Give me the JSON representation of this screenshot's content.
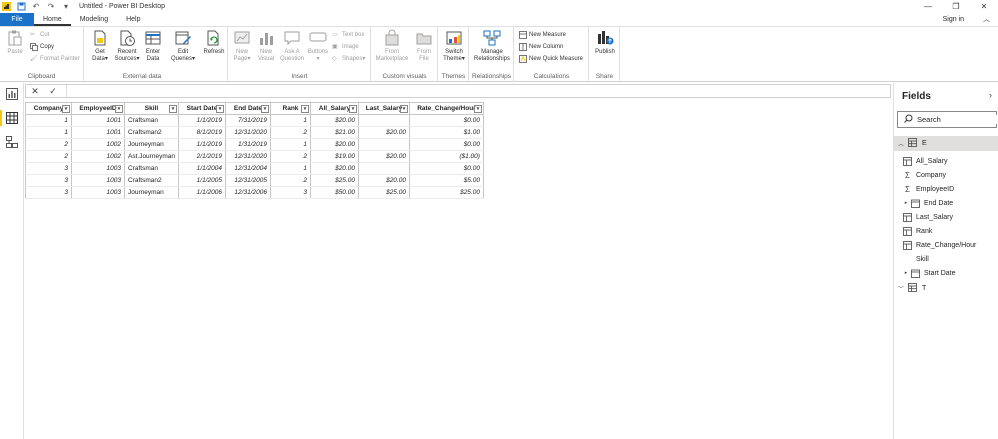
{
  "window": {
    "title": "Untitled - Power BI Desktop",
    "minimize_icon": "minimize-icon",
    "restore_icon": "restore-icon",
    "close_icon": "close-icon"
  },
  "tabs": [
    {
      "label": "File"
    },
    {
      "label": "Home"
    },
    {
      "label": "Modeling"
    },
    {
      "label": "Help"
    }
  ],
  "signin": "Sign in",
  "ribbon": {
    "clipboard": {
      "label": "Clipboard",
      "paste": "Paste",
      "cut": "Cut",
      "copy": "Copy",
      "format_painter": "Format Painter"
    },
    "external_data": {
      "label": "External data",
      "get_data": "Get Data",
      "recent_sources": "Recent Sources",
      "enter_data": "Enter Data",
      "edit_queries": "Edit Queries"
    },
    "refresh": "Refresh",
    "insert": {
      "label": "Insert",
      "new_page": "New Page",
      "new_visual": "New Visual",
      "ask_question": "Ask A Question",
      "buttons": "Buttons",
      "text_box": "Text box",
      "image": "Image",
      "shapes": "Shapes"
    },
    "custom_visuals": {
      "label": "Custom visuals",
      "from_marketplace": "From Marketplace",
      "from_file": "From File"
    },
    "themes": {
      "label": "Themes",
      "switch_theme": "Switch Theme"
    },
    "relationships": {
      "label": "Relationships",
      "manage": "Manage Relationships"
    },
    "calculations": {
      "label": "Calculations",
      "new_measure": "New Measure",
      "new_column": "New Column",
      "new_quick_measure": "New Quick Measure"
    },
    "share": {
      "label": "Share",
      "publish": "Publish"
    }
  },
  "table": {
    "columns": [
      "Company",
      "EmployeeID",
      "Skill",
      "Start Date",
      "End Date",
      "Rank",
      "All_Salary",
      "Last_Salary",
      "Rate_Change/Hour"
    ],
    "rows": [
      [
        "1",
        "1001",
        "Craftsman",
        "1/1/2019",
        "7/31/2019",
        "1",
        "$20.00",
        "",
        "$0.00"
      ],
      [
        "1",
        "1001",
        "Craftsman2",
        "8/1/2019",
        "12/31/2020",
        "2",
        "$21.00",
        "$20.00",
        "$1.00"
      ],
      [
        "2",
        "1002",
        "Journeyman",
        "1/1/2019",
        "1/31/2019",
        "1",
        "$20.00",
        "",
        "$0.00"
      ],
      [
        "2",
        "1002",
        "Ast.Journeyman",
        "2/1/2019",
        "12/31/2020",
        "2",
        "$19.00",
        "$20.00",
        "($1.00)"
      ],
      [
        "3",
        "1003",
        "Craftsman",
        "1/1/2004",
        "12/31/2004",
        "1",
        "$20.00",
        "",
        "$0.00"
      ],
      [
        "3",
        "1003",
        "Craftsman2",
        "1/1/2005",
        "12/31/2005",
        "2",
        "$25.00",
        "$20.00",
        "$5.00"
      ],
      [
        "3",
        "1003",
        "Journeyman",
        "1/1/2006",
        "12/31/2006",
        "3",
        "$50.00",
        "$25.00",
        "$25.00"
      ]
    ]
  },
  "fields_pane": {
    "title": "Fields",
    "search_placeholder": "Search",
    "tables": [
      {
        "name": "E",
        "expanded": true,
        "fields": [
          {
            "name": "All_Salary",
            "icon": "table-calc-icon"
          },
          {
            "name": "Company",
            "icon": "sigma-icon"
          },
          {
            "name": "EmployeeID",
            "icon": "sigma-icon"
          },
          {
            "name": "End Date",
            "icon": "calendar-hierarchy-icon"
          },
          {
            "name": "Last_Salary",
            "icon": "table-calc-icon"
          },
          {
            "name": "Rank",
            "icon": "table-calc-icon"
          },
          {
            "name": "Rate_Change/Hour",
            "icon": "table-calc-icon"
          },
          {
            "name": "Skill",
            "icon": "none"
          },
          {
            "name": "Start Date",
            "icon": "calendar-hierarchy-icon"
          }
        ]
      },
      {
        "name": "T",
        "expanded": false
      }
    ]
  },
  "colors": {
    "file_tab": "#1a73c8",
    "accent_yellow": "#f2c811",
    "selected_row": "#e1dfdd"
  }
}
